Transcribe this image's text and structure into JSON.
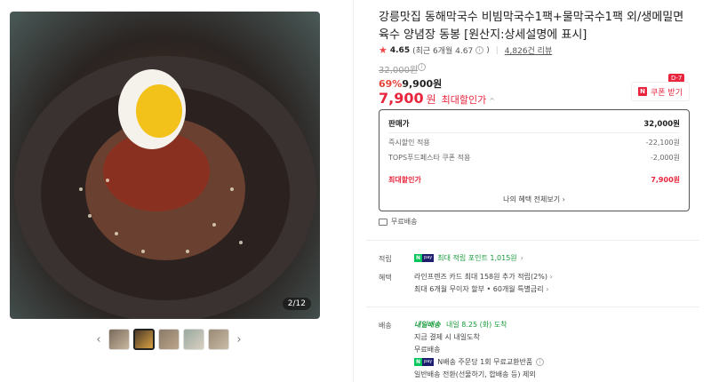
{
  "product": {
    "title": "강릉맛집 동해막국수 비빔막국수1팩+물막국수1팩 외/생메밀면 육수 양념장 동봉 [원산지:상세설명에 표시]",
    "rating": "4.65",
    "rating_detail": "(최근 6개월 4.67",
    "review_count": "4,826건 리뷰"
  },
  "gallery": {
    "counter": "2/12",
    "prev_icon": "chevron-left-icon",
    "next_icon": "chevron-right-icon"
  },
  "price": {
    "original": "32,000원",
    "discount_rate": "69%",
    "discount_price": "9,900원",
    "max_price": "7,900",
    "max_unit": "원",
    "max_label": "최대할인가",
    "coupon_label": "쿠폰 받기",
    "coupon_n": "N",
    "dday": "D-7"
  },
  "price_box": {
    "rows": [
      {
        "label": "판매가",
        "value": "32,000원"
      },
      {
        "label": "즉시할인 적용",
        "value": "-22,100원"
      },
      {
        "label": "TOPS푸드페스타 쿠폰 적용",
        "value": "-2,000원"
      }
    ],
    "max_label": "최대할인가",
    "max_value": "7,900원",
    "view_all": "나의 혜택 전체보기 ›"
  },
  "shipping_free": "무료배송",
  "points": {
    "label": "적립",
    "text": "최대 적립 포인트 1,015원"
  },
  "benefits": {
    "label": "혜택",
    "line1": "라인프렌즈 카드 최대 158원 추가 적립(2%)",
    "line2": "최대 6개월 무이자 할부 • 60개월 특별금리"
  },
  "delivery": {
    "label": "배송",
    "tomorrow_badge": "내일배송",
    "arrival": "내일 8.25 (화) 도착",
    "line2": "지금 결제 시 내일도착",
    "line3": "무료배송",
    "line4": "N배송 주문당 1회 무료교환반품",
    "line5": "일반배송 전환(선물하기, 합배송 등) 제외"
  },
  "colors": {
    "accent_red": "#e8253c",
    "naver_green": "#03c75a"
  }
}
